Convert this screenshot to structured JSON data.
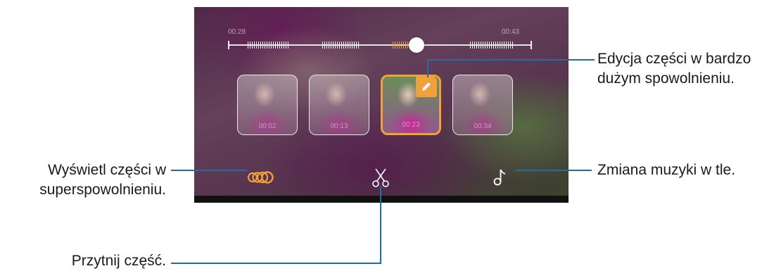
{
  "video": {
    "time_start": "00:28",
    "time_end": "00:43",
    "clips": [
      {
        "time": "00:02"
      },
      {
        "time": "00:13"
      },
      {
        "time": "00:23"
      },
      {
        "time": "00:34"
      }
    ]
  },
  "callouts": {
    "edit_slowmo_line1": "Edycja części w bardzo",
    "edit_slowmo_line2": "dużym spowolnieniu.",
    "view_slowmo_line1": "Wyświetl części w",
    "view_slowmo_line2": "superspowolnieniu.",
    "change_music": "Zmiana muzyki w tle.",
    "trim": "Przytnij część."
  },
  "icons": {
    "edit": "pencil-icon",
    "slowmo": "slow-motion-icon",
    "trim": "scissors-icon",
    "music": "music-note-icon"
  },
  "colors": {
    "accent": "#f0a13a",
    "callout_line": "#1f6fa0"
  }
}
